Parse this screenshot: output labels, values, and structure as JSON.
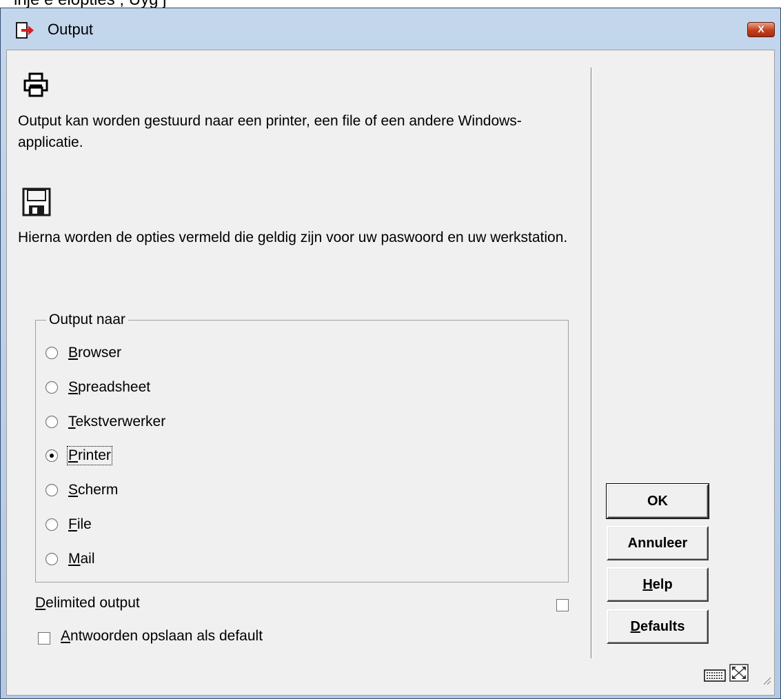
{
  "background": {
    "partial_text": "inje      e  elopties  ;  Uyg  j"
  },
  "window": {
    "title": "Output",
    "close_label": "X"
  },
  "info": {
    "printer_text": "Output kan worden gestuurd naar een printer, een file of een andere Windows-applicatie.",
    "save_text": "Hierna worden de opties vermeld die geldig zijn voor uw paswoord en uw werkstation."
  },
  "output_group": {
    "legend": "Output naar",
    "options": [
      {
        "key": "B",
        "rest": "rowser",
        "selected": false
      },
      {
        "key": "S",
        "rest": "preadsheet",
        "selected": false
      },
      {
        "key": "T",
        "rest": "ekstverwerker",
        "selected": false
      },
      {
        "key": "P",
        "rest": "rinter",
        "selected": true
      },
      {
        "key": "S",
        "rest": "cherm",
        "selected": false
      },
      {
        "key": "F",
        "rest": "ile",
        "selected": false
      },
      {
        "key": "M",
        "rest": "ail",
        "selected": false
      }
    ]
  },
  "delimited": {
    "key": "D",
    "rest": "elimited output",
    "checked": false
  },
  "save_default": {
    "key": "A",
    "rest": "ntwoorden opslaan als default",
    "checked": false
  },
  "buttons": {
    "ok": "OK",
    "annuleer": "Annuleer",
    "help_key": "H",
    "help_rest": "elp",
    "defaults_key": "D",
    "defaults_rest": "efaults"
  },
  "icons": [
    "exit-icon",
    "printer-icon",
    "floppy-disk-icon",
    "keyboard-icon",
    "resize-icon",
    "size-grip-icon"
  ]
}
